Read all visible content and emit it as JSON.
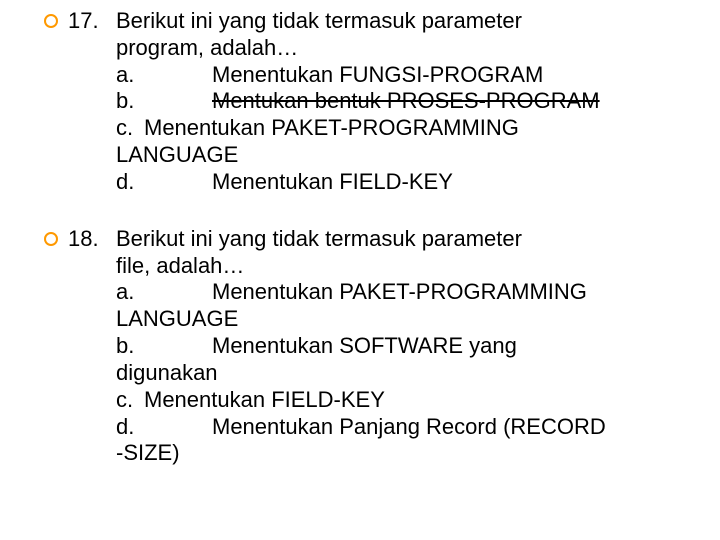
{
  "q17": {
    "number": "17.",
    "question_l1": "Berikut ini yang tidak termasuk parameter",
    "question_l2": "program, adalah…",
    "a_label": "a.",
    "a_text": "Menentukan FUNGSI-PROGRAM",
    "b_label": "b.",
    "b_text": "Mentukan bentuk PROSES-PROGRAM",
    "c_label": "c.",
    "c_text": "Menentukan PAKET-PROGRAMMING",
    "c_cont": "LANGUAGE",
    "d_label": "d.",
    "d_text": "Menentukan FIELD-KEY"
  },
  "q18": {
    "number": "18.",
    "question_l1": "Berikut ini yang tidak termasuk parameter",
    "question_l2": "file, adalah…",
    "a_label": "a.",
    "a_text": "Menentukan PAKET-PROGRAMMING",
    "a_cont": "LANGUAGE",
    "b_label": "b.",
    "b_text": "Menentukan SOFTWARE yang",
    "b_cont": "digunakan",
    "c_label": "c.",
    "c_text": "Menentukan FIELD-KEY",
    "d_label": "d.",
    "d_text": "Menentukan Panjang Record (RECORD",
    "d_cont": "-SIZE)"
  }
}
